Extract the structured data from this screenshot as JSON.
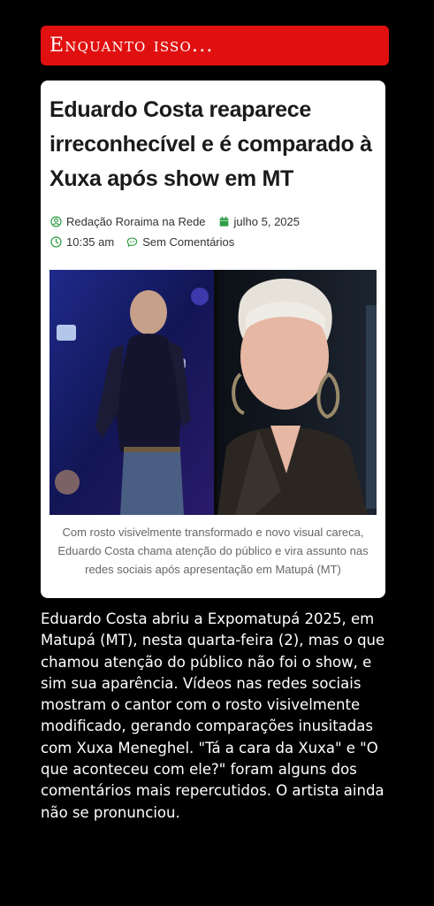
{
  "banner": {
    "title": "Enquanto isso..."
  },
  "article": {
    "headline": "Eduardo Costa reaparece irreconhecível e é comparado à Xuxa após show em MT",
    "author": "Redação Roraima na Rede",
    "date": "julho 5, 2025",
    "time": "10:35 am",
    "comments": "Sem Comentários",
    "caption": "Com rosto visivelmente transformado e novo visual careca, Eduardo Costa chama atenção do público e vira assunto nas redes sociais após apresentação em Matupá (MT)"
  },
  "icons": {
    "author": "user-circle-icon",
    "date": "calendar-icon",
    "time": "clock-icon",
    "comments": "comment-bubble-icon"
  },
  "colors": {
    "background": "#000000",
    "banner": "#e11010",
    "card": "#ffffff",
    "icon_accent": "#2e9e46"
  },
  "body": {
    "text": "Eduardo Costa abriu a Expomatupá 2025, em Matupá (MT), nesta quarta-feira (2), mas o que chamou atenção do público não foi o show, e sim sua aparência. Vídeos nas redes sociais mostram o cantor com o rosto visivelmente modificado, gerando comparações inusitadas com Xuxa Meneghel. \"Tá a cara da Xuxa\" e \"O que aconteceu com ele?\" foram alguns dos comentários mais repercutidos. O artista ainda não se pronunciou."
  }
}
